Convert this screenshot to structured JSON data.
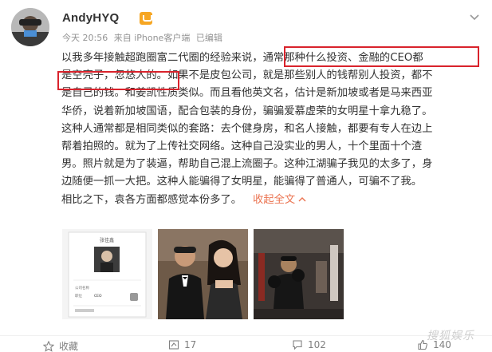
{
  "author": {
    "name": "AndyHYQ",
    "badge": "vip-badge-icon"
  },
  "meta": {
    "time": "今天 20:56",
    "source": "来自 iPhone客户端",
    "edited": "已编辑"
  },
  "post": {
    "lines": [
      "以我多年接触超跑圈富二代圈的经验来说，通常那种什么投资、金融的CEO都",
      "是空壳子，忽悠人的。如果不是皮包公司，就是那些别人的钱帮别人投资，都不",
      "是自己的钱。和姜凯性质类似。而且看他英文名，估计是新加坡或者是马来西亚",
      "华侨，说着新加坡国语，配合包装的身份，骗骗爱慕虚荣的女明星十拿九稳了。",
      "这种人通常都是相同类似的套路：去个健身房，和名人接触，都要有专人在边上",
      "帮着拍照的。就为了上传社交网络。这种自己没实业的男人，十个里面十个渣",
      "男。照片就是为了装逼，帮助自己混上流圈子。这种江湖骗子我见的太多了，身",
      "边随便一抓一大把。这种人能骗得了女明星，能骗得了普通人，可骗不了我。"
    ],
    "last_line": "相比之下，袁各方面都感觉本份多了。",
    "collapse_label": "收起全文",
    "highlight_color": "#d9232c",
    "link_color": "#eb7350"
  },
  "images": [
    {
      "name": "profile-card-image",
      "card_name": "张佳鑫",
      "rows": [
        "公司名称",
        "职位",
        "CEO"
      ]
    },
    {
      "name": "couple-photo-image"
    },
    {
      "name": "gym-photo-image"
    }
  ],
  "actions": {
    "favorite_label": "收藏",
    "repost_count": "17",
    "comment_count": "102",
    "like_count": "140"
  },
  "watermark": "搜狐娱乐"
}
